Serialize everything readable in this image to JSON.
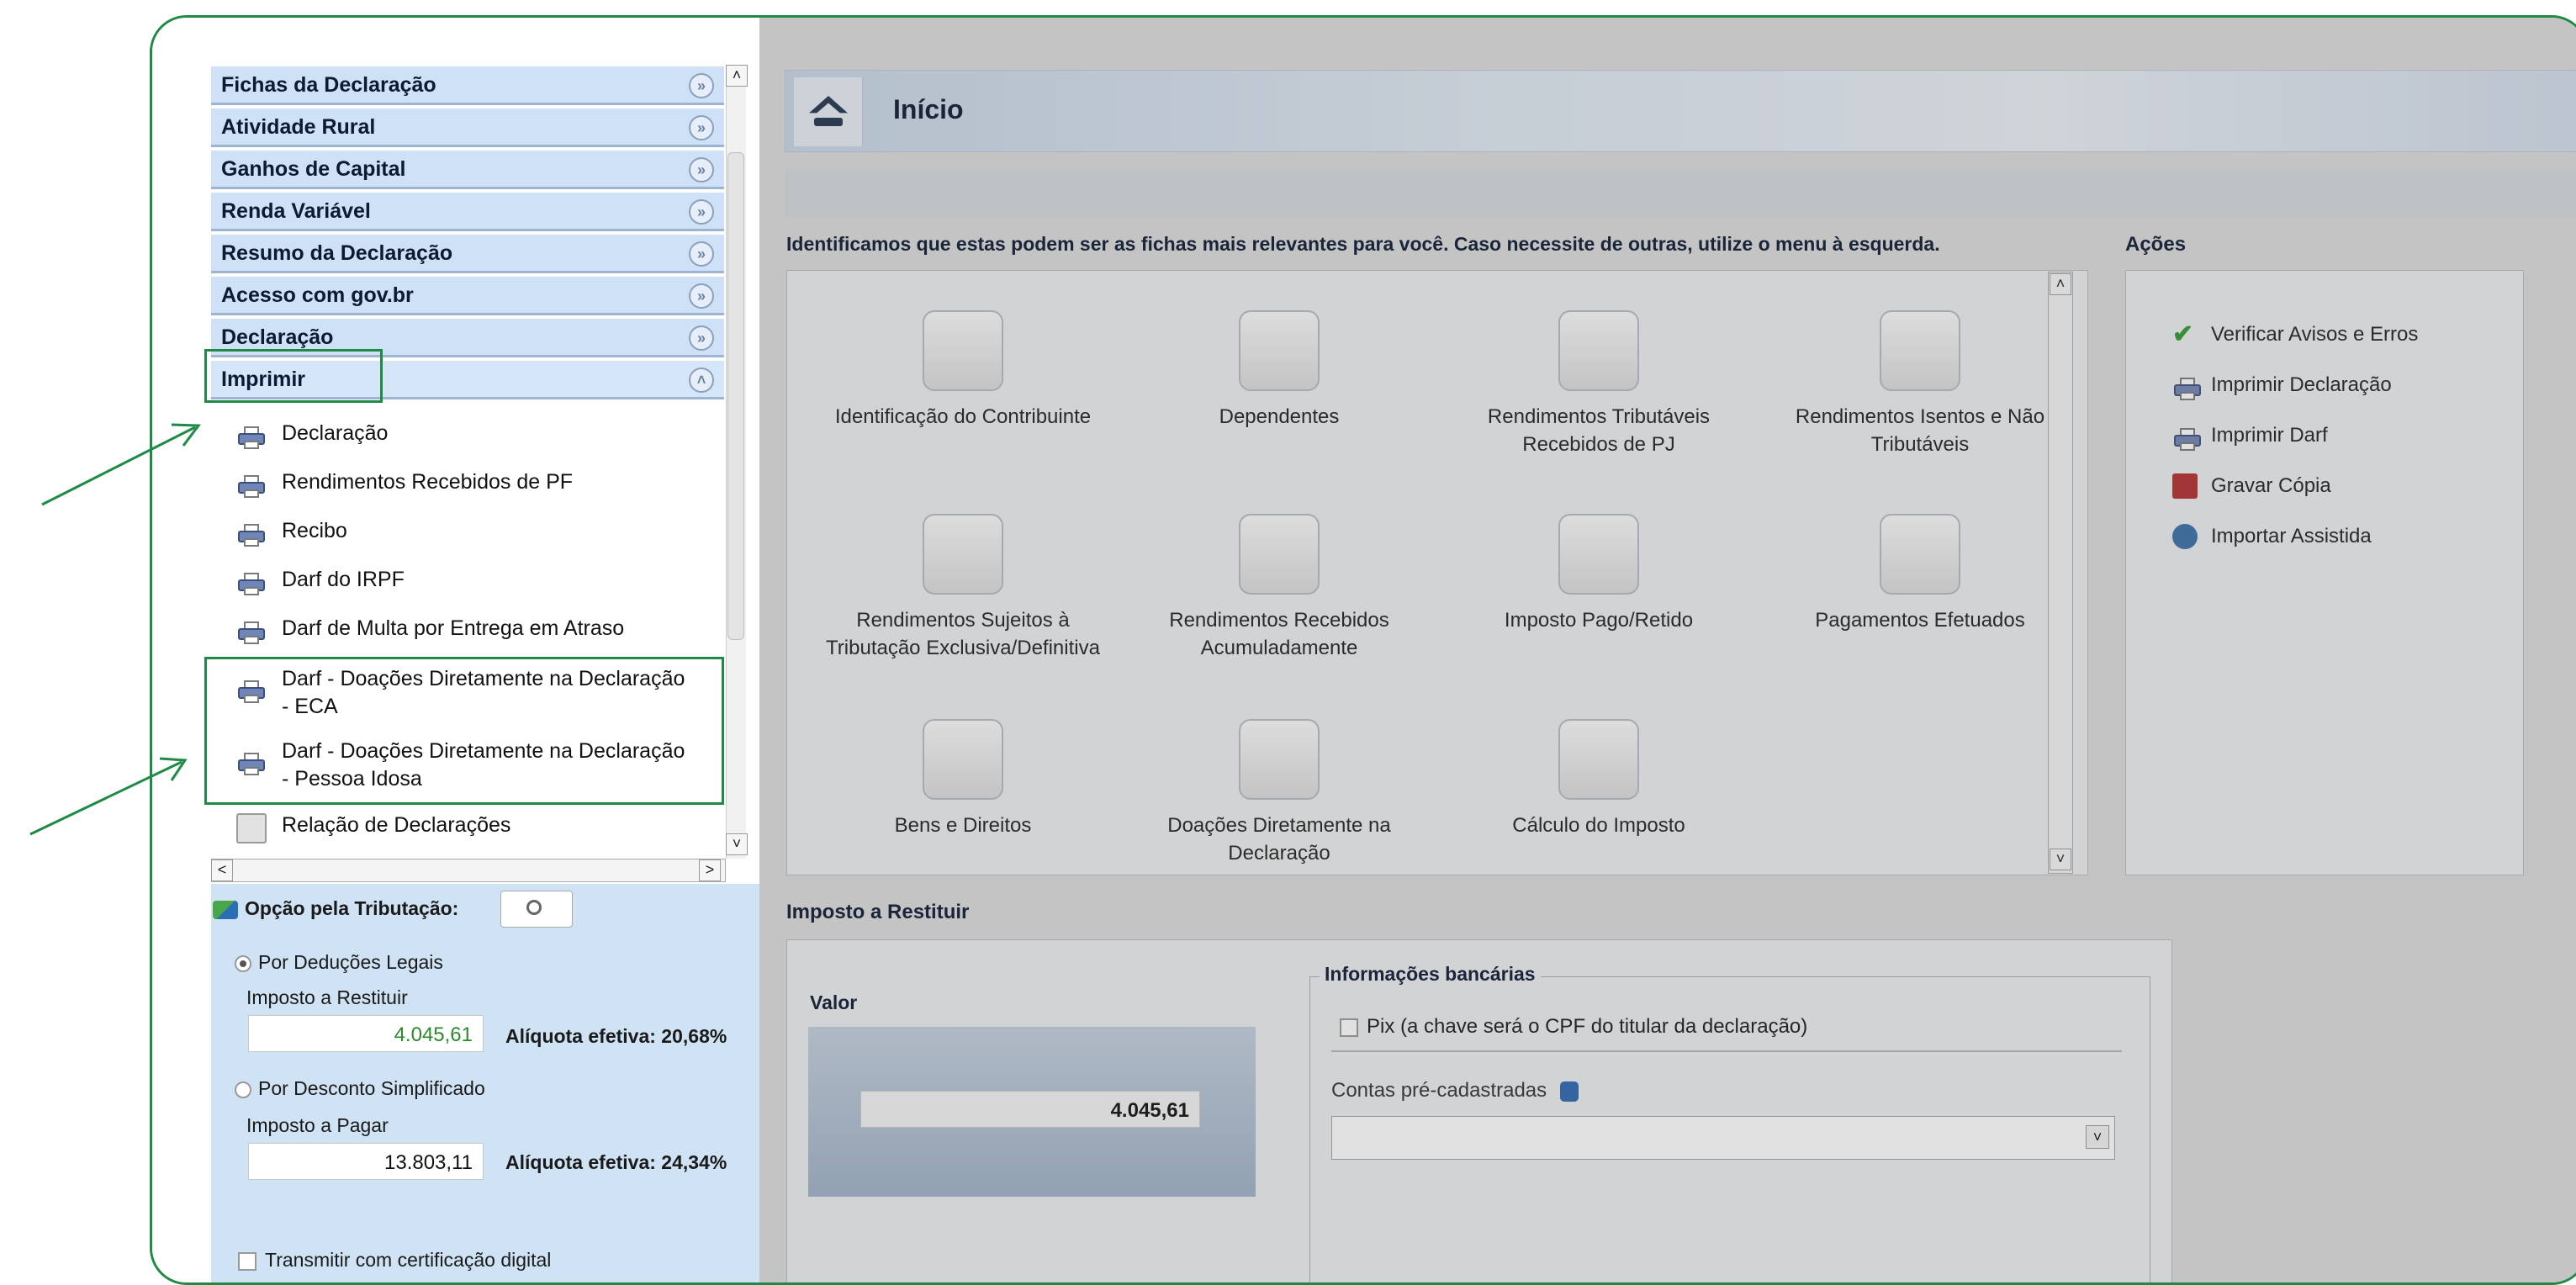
{
  "sidebar": {
    "sections": [
      "Fichas da Declaração",
      "Atividade Rural",
      "Ganhos de Capital",
      "Renda Variável",
      "Resumo da Declaração",
      "Acesso com gov.br",
      "Declaração",
      "Imprimir"
    ],
    "imprimir_items": [
      "Declaração",
      "Rendimentos Recebidos de PF",
      "Recibo",
      "Darf do IRPF",
      "Darf de Multa por Entrega em Atraso",
      "Darf - Doações Diretamente na Declaração - ECA",
      "Darf - Doações Diretamente na Declaração - Pessoa Idosa",
      "Relação de Declarações"
    ]
  },
  "tributacao": {
    "label": "Opção pela Tributação:",
    "deducoes_label": "Por Deduções Legais",
    "restituir_label": "Imposto a Restituir",
    "restituir_value": "4.045,61",
    "aliquota1": "Alíquota efetiva: 20,68%",
    "simplificado_label": "Por Desconto Simplificado",
    "pagar_label": "Imposto a Pagar",
    "pagar_value": "13.803,11",
    "aliquota2": "Alíquota efetiva: 24,34%",
    "transmitir_label": "Transmitir com certificação digital"
  },
  "header": {
    "title": "Início"
  },
  "intro": "Identificamos que estas podem ser as fichas mais relevantes para você. Caso necessite de outras, utilize o menu à esquerda.",
  "fichas": [
    "Identificação do Contribuinte",
    "Dependentes",
    "Rendimentos Tributáveis Recebidos de PJ",
    "Rendimentos Isentos e Não Tributáveis",
    "Rendimentos Sujeitos à Tributação Exclusiva/Definitiva",
    "Rendimentos Recebidos Acumuladamente",
    "Imposto Pago/Retido",
    "Pagamentos Efetuados",
    "Bens e Direitos",
    "Doações Diretamente na Declaração",
    "Cálculo do Imposto"
  ],
  "acoes": {
    "title": "Ações",
    "items": [
      "Verificar Avisos e Erros",
      "Imprimir Declaração",
      "Imprimir Darf",
      "Gravar Cópia",
      "Importar Assistida"
    ]
  },
  "restituir": {
    "title": "Imposto a Restituir",
    "valor_label": "Valor",
    "valor": "4.045,61",
    "bank_title": "Informações bancárias",
    "pix_label": "Pix (a chave será o CPF do titular da declaração)",
    "contas_label": "Contas pré-cadastradas"
  },
  "colors": {
    "accent": "#1f8a45",
    "sidebar_header": "#cfe1f6",
    "panel_blue": "#cfe3f5"
  }
}
